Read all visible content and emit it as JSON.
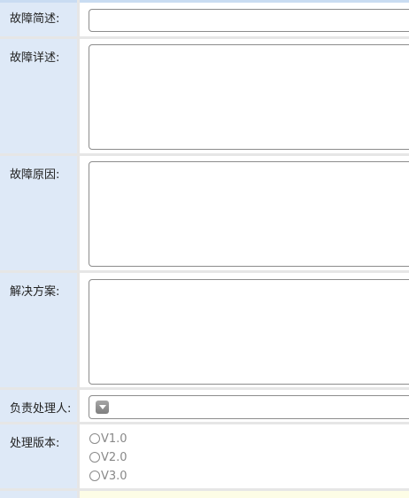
{
  "form": {
    "brief": {
      "label": "故障简述:",
      "value": ""
    },
    "detail": {
      "label": "故障详述:",
      "value": ""
    },
    "cause": {
      "label": "故障原因:",
      "value": ""
    },
    "solution": {
      "label": "解决方案:",
      "value": ""
    },
    "handler": {
      "label": "负责处理人:",
      "selected": "",
      "dropdown_icon": "dropdown-arrow-icon"
    },
    "version": {
      "label": "处理版本:",
      "options": [
        "V1.0",
        "V2.0",
        "V3.0"
      ],
      "checked": null
    }
  },
  "colors": {
    "label_bg": "#dee9f7",
    "field_bg": "#ffffff",
    "border": "#8c8c8c",
    "next_row_bg": "#fdfde6"
  }
}
